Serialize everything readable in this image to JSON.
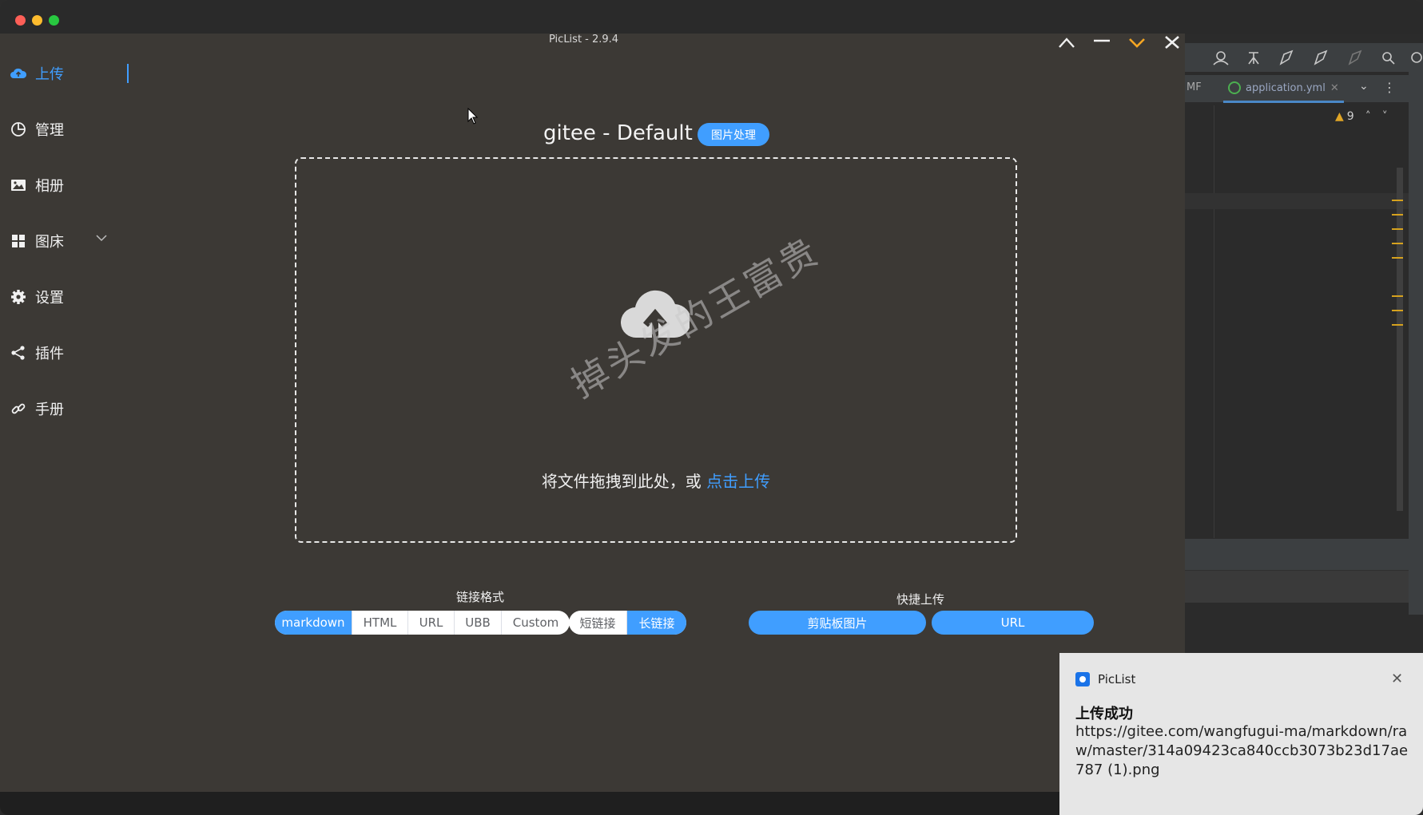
{
  "app": {
    "title": "PicList - 2.9.4"
  },
  "sidebar": {
    "items": [
      {
        "label": "上传",
        "icon": "cloud-upload-icon"
      },
      {
        "label": "管理",
        "icon": "pie-chart-icon"
      },
      {
        "label": "相册",
        "icon": "picture-icon"
      },
      {
        "label": "图床",
        "icon": "grid-icon"
      },
      {
        "label": "设置",
        "icon": "gear-icon"
      },
      {
        "label": "插件",
        "icon": "share-icon"
      },
      {
        "label": "手册",
        "icon": "link-icon"
      }
    ]
  },
  "upload": {
    "picbed": "gitee - Default",
    "image_process_label": "图片处理",
    "drop_text": "将文件拖拽到此处，或 ",
    "drop_link": "点击上传",
    "watermark": "掉头发的王富贵"
  },
  "link_format": {
    "label": "链接格式",
    "options": [
      "markdown",
      "HTML",
      "URL",
      "UBB",
      "Custom"
    ],
    "selected": "markdown",
    "length_options": [
      "短链接",
      "长链接"
    ],
    "length_selected": "长链接"
  },
  "quick_upload": {
    "label": "快捷上传",
    "clipboard_label": "剪贴板图片",
    "url_label": "URL"
  },
  "ide": {
    "left_tab": "MF",
    "active_tab": "application.yml",
    "warning_count": "9"
  },
  "toast": {
    "app_name": "PicList",
    "title": "上传成功",
    "body": "https://gitee.com/wangfugui-ma/markdown/raw/master/314a09423ca840ccb3073b23d17ae787 (1).png"
  },
  "colors": {
    "accent": "#409eff",
    "app_bg": "#3c3935"
  }
}
